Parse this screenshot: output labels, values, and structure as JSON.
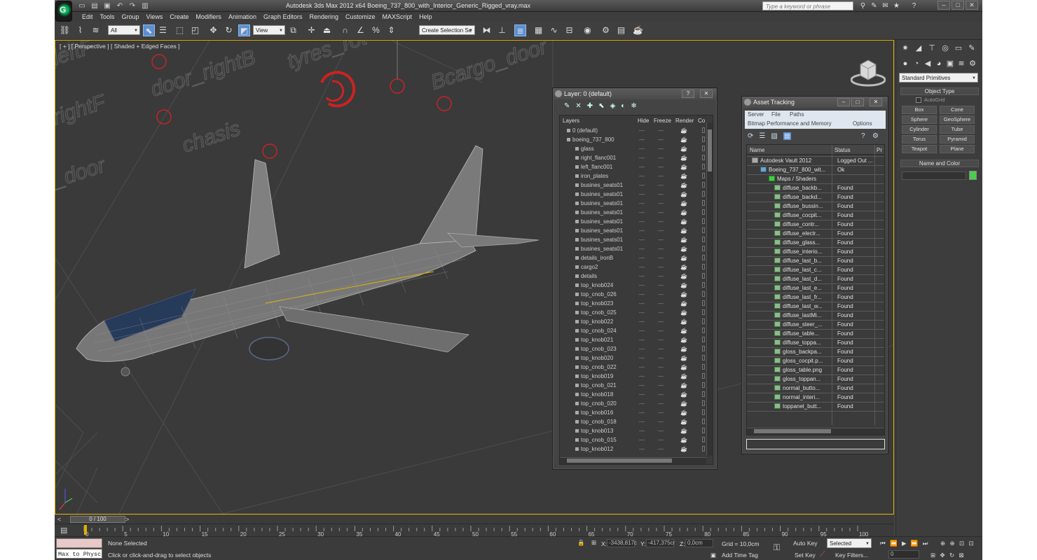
{
  "app": {
    "title": "Autodesk 3ds Max  2012 x64      Boeing_737_800_with_Interior_Generic_Rigged_vray.max",
    "search_placeholder": "Type a keyword or phrase"
  },
  "menu": [
    "Edit",
    "Tools",
    "Group",
    "Views",
    "Create",
    "Modifiers",
    "Animation",
    "Graph Editors",
    "Rendering",
    "Customize",
    "MAXScript",
    "Help"
  ],
  "toolbar": {
    "filter_select": "All",
    "coord_select": "View",
    "selection_set": "Create Selection Se"
  },
  "viewport": {
    "label": "[ + ] [ Perspective ] [ Shaded + Edged Faces ]",
    "helper_labels": [
      "door_rightB",
      "tyres_rot",
      "Bcargo_door",
      "chasis",
      "_door",
      "rightF",
      "leftF"
    ]
  },
  "time": {
    "slider": "0 / 100",
    "ticks": [
      "0",
      "5",
      "10",
      "15",
      "20",
      "25",
      "30",
      "35",
      "40",
      "45",
      "50",
      "55",
      "60",
      "65",
      "70",
      "75",
      "80",
      "85",
      "90",
      "95",
      "100"
    ]
  },
  "status": {
    "maxscript": "Max to Physc",
    "selection": "None Selected",
    "prompt": "Click or click-and-drag to select objects",
    "x_label": "X:",
    "x_value": "-3438,817c",
    "y_label": "Y:",
    "y_value": "-417,375cr",
    "z_label": "Z:",
    "z_value": "0,0cm",
    "grid": "Grid = 10,0cm",
    "add_time_tag": "Add Time Tag",
    "auto_key": "Auto Key",
    "set_key": "Set Key",
    "key_mode": "Selected",
    "key_filters": "Key Filters...",
    "frame": "0"
  },
  "command_panel": {
    "category": "Standard Primitives",
    "object_type_title": "Object Type",
    "autogrid": "AutoGrid",
    "buttons": [
      "Box",
      "Cone",
      "Sphere",
      "GeoSphere",
      "Cylinder",
      "Tube",
      "Torus",
      "Pyramid",
      "Teapot",
      "Plane"
    ],
    "name_color_title": "Name and Color",
    "color": "#4ccc4c"
  },
  "layer_dialog": {
    "title": "Layer: 0 (default)",
    "columns": [
      "Layers",
      "Hide",
      "Freeze",
      "Render",
      "Co"
    ],
    "layers": [
      {
        "name": "0 (default)",
        "level": 0
      },
      {
        "name": "boeing_737_800",
        "level": 0
      },
      {
        "name": "glass",
        "level": 1
      },
      {
        "name": "right_flanc001",
        "level": 1
      },
      {
        "name": "left_flanc001",
        "level": 1
      },
      {
        "name": "iron_plates",
        "level": 1
      },
      {
        "name": "busines_seats01",
        "level": 1
      },
      {
        "name": "busines_seats01",
        "level": 1
      },
      {
        "name": "busines_seats01",
        "level": 1
      },
      {
        "name": "busines_seats01",
        "level": 1
      },
      {
        "name": "busines_seats01",
        "level": 1
      },
      {
        "name": "busines_seats01",
        "level": 1
      },
      {
        "name": "busines_seats01",
        "level": 1
      },
      {
        "name": "busines_seats01",
        "level": 1
      },
      {
        "name": "details_ironB",
        "level": 1
      },
      {
        "name": "cargo2",
        "level": 1
      },
      {
        "name": "details",
        "level": 1
      },
      {
        "name": "top_knob024",
        "level": 1
      },
      {
        "name": "top_cnob_026",
        "level": 1
      },
      {
        "name": "top_knob023",
        "level": 1
      },
      {
        "name": "top_cnob_025",
        "level": 1
      },
      {
        "name": "top_knob022",
        "level": 1
      },
      {
        "name": "top_cnob_024",
        "level": 1
      },
      {
        "name": "top_knob021",
        "level": 1
      },
      {
        "name": "top_cnob_023",
        "level": 1
      },
      {
        "name": "top_knob020",
        "level": 1
      },
      {
        "name": "top_cnob_022",
        "level": 1
      },
      {
        "name": "top_knob019",
        "level": 1
      },
      {
        "name": "top_cnob_021",
        "level": 1
      },
      {
        "name": "top_knob018",
        "level": 1
      },
      {
        "name": "top_cnob_020",
        "level": 1
      },
      {
        "name": "top_knob016",
        "level": 1
      },
      {
        "name": "top_cnob_018",
        "level": 1
      },
      {
        "name": "top_knob013",
        "level": 1
      },
      {
        "name": "top_cnob_015",
        "level": 1
      },
      {
        "name": "top_knob012",
        "level": 1
      }
    ]
  },
  "asset_dialog": {
    "title": "Asset Tracking",
    "menu1": [
      "Server",
      "File",
      "Paths"
    ],
    "menu2": [
      "Bitmap Performance and Memory",
      "Options"
    ],
    "columns": [
      "Name",
      "Status",
      "Pr"
    ],
    "rows": [
      {
        "name": "Autodesk Vault 2012",
        "status": "Logged Out ...",
        "level": 0,
        "icon": "vault"
      },
      {
        "name": "Boeing_737_800_wit...",
        "status": "Ok",
        "level": 1,
        "icon": "max"
      },
      {
        "name": "Maps / Shaders",
        "status": "",
        "level": 2,
        "icon": "folder"
      },
      {
        "name": "diffuse_backb...",
        "status": "Found",
        "level": 3,
        "icon": "file"
      },
      {
        "name": "diffuse_backd...",
        "status": "Found",
        "level": 3,
        "icon": "file"
      },
      {
        "name": "diffuse_bussin...",
        "status": "Found",
        "level": 3,
        "icon": "file"
      },
      {
        "name": "diffuse_cocpit...",
        "status": "Found",
        "level": 3,
        "icon": "file"
      },
      {
        "name": "diffuse_contr...",
        "status": "Found",
        "level": 3,
        "icon": "file"
      },
      {
        "name": "diffuse_electr...",
        "status": "Found",
        "level": 3,
        "icon": "file"
      },
      {
        "name": "diffuse_glass...",
        "status": "Found",
        "level": 3,
        "icon": "file"
      },
      {
        "name": "diffuse_interio...",
        "status": "Found",
        "level": 3,
        "icon": "file"
      },
      {
        "name": "diffuse_last_b...",
        "status": "Found",
        "level": 3,
        "icon": "file"
      },
      {
        "name": "diffuse_last_c...",
        "status": "Found",
        "level": 3,
        "icon": "file"
      },
      {
        "name": "diffuse_last_d...",
        "status": "Found",
        "level": 3,
        "icon": "file"
      },
      {
        "name": "diffuse_last_e...",
        "status": "Found",
        "level": 3,
        "icon": "file"
      },
      {
        "name": "diffuse_last_fr...",
        "status": "Found",
        "level": 3,
        "icon": "file"
      },
      {
        "name": "diffuse_last_w...",
        "status": "Found",
        "level": 3,
        "icon": "file"
      },
      {
        "name": "diffuse_lastMi...",
        "status": "Found",
        "level": 3,
        "icon": "file"
      },
      {
        "name": "diffuse_steer_...",
        "status": "Found",
        "level": 3,
        "icon": "file"
      },
      {
        "name": "diffuse_table...",
        "status": "Found",
        "level": 3,
        "icon": "file"
      },
      {
        "name": "diffuse_toppa...",
        "status": "Found",
        "level": 3,
        "icon": "file"
      },
      {
        "name": "gloss_backpa...",
        "status": "Found",
        "level": 3,
        "icon": "file"
      },
      {
        "name": "gloss_cocpit.p...",
        "status": "Found",
        "level": 3,
        "icon": "file"
      },
      {
        "name": "gloss_table.png",
        "status": "Found",
        "level": 3,
        "icon": "file"
      },
      {
        "name": "gloss_toppan...",
        "status": "Found",
        "level": 3,
        "icon": "file"
      },
      {
        "name": "normal_butto...",
        "status": "Found",
        "level": 3,
        "icon": "file"
      },
      {
        "name": "normal_interi...",
        "status": "Found",
        "level": 3,
        "icon": "file"
      },
      {
        "name": "toppanel_butt...",
        "status": "Found",
        "level": 3,
        "icon": "file"
      }
    ]
  }
}
